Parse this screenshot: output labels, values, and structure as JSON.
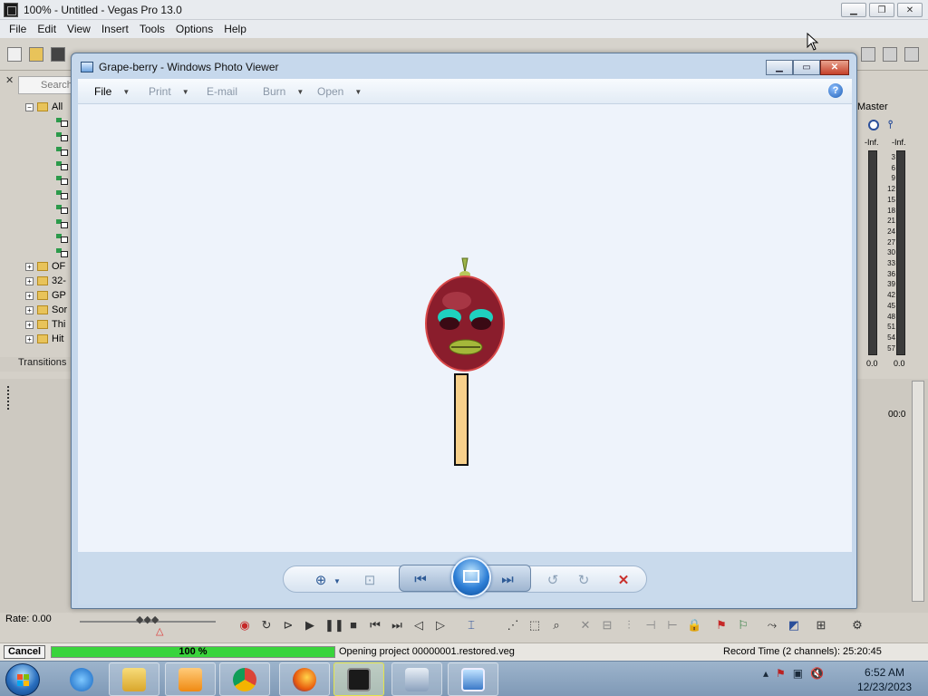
{
  "vegas": {
    "title": "100% - Untitled - Vegas Pro 13.0",
    "menu": [
      "File",
      "Edit",
      "View",
      "Insert",
      "Tools",
      "Options",
      "Help"
    ],
    "search_placeholder": "Search",
    "tree_root_label": "All",
    "folders": [
      "OF",
      "32-",
      "GP",
      "Sor",
      "Thi",
      "Hit"
    ],
    "transitions_tab": "Transitions",
    "master_label": "Master",
    "meter_top_left": "-Inf.",
    "meter_top_right": "-Inf.",
    "meter_scale": [
      "3",
      "6",
      "9",
      "12",
      "15",
      "18",
      "21",
      "24",
      "27",
      "30",
      "33",
      "36",
      "39",
      "42",
      "45",
      "48",
      "51",
      "54",
      "57"
    ],
    "meter_foot_left": "0.0",
    "meter_foot_right": "0.0",
    "timeline_time": "00:0",
    "rate": "Rate: 0.00"
  },
  "status": {
    "cancel_label": "Cancel",
    "progress_percent": 100,
    "progress_text": "100 %",
    "message": "Opening project 00000001.restored.veg",
    "record_time": "Record Time (2 channels): 25:20:45"
  },
  "photo_viewer": {
    "title": "Grape-berry - Windows Photo Viewer",
    "menu": {
      "file": "File",
      "print": "Print",
      "email": "E-mail",
      "burn": "Burn",
      "open": "Open"
    },
    "help_glyph": "?"
  },
  "taskbar": {
    "time": "6:52 AM",
    "date": "12/23/2023"
  },
  "colors": {
    "progress_green": "#39d43b",
    "photo_canvas": "#eef3fb",
    "delete_red": "#c9302c"
  }
}
